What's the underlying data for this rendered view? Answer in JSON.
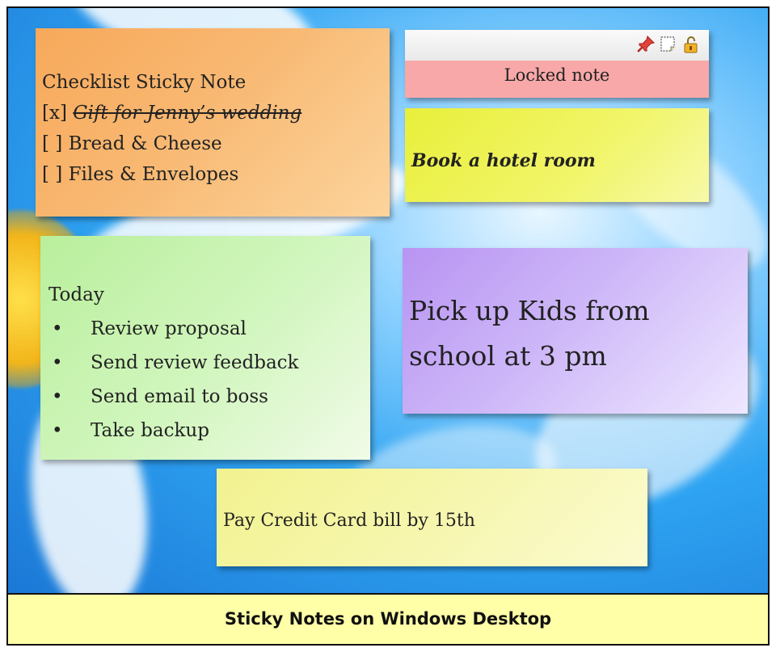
{
  "notes": {
    "checklist": {
      "title": "Checklist Sticky Note",
      "items": [
        {
          "mark": "[x]",
          "text": "Gift for Jenny’s wedding"
        },
        {
          "mark": "[ ]",
          "text": "Bread & Cheese"
        },
        {
          "mark": "[ ]",
          "text": "Files & Envelopes"
        }
      ],
      "color": "#f8b872"
    },
    "locked": {
      "label": "Locked note",
      "toolbar_icons": [
        "pin-icon",
        "note-icon",
        "lock-icon"
      ],
      "color": "#f8a8a8"
    },
    "hotel": {
      "text": "Book a hotel room",
      "color": "#eef25a"
    },
    "today": {
      "title": "Today",
      "bullets": [
        "Review proposal",
        "Send review feedback",
        "Send email to boss",
        "Take backup"
      ],
      "color": "#c9f3b2"
    },
    "kids": {
      "line1": "Pick up Kids from",
      "line2": "school at 3 pm",
      "color": "#c8aaf6"
    },
    "bill": {
      "text": "Pay Credit Card bill by 15th",
      "color": "#f5f5a6"
    }
  },
  "caption": "Sticky Notes on Windows Desktop"
}
